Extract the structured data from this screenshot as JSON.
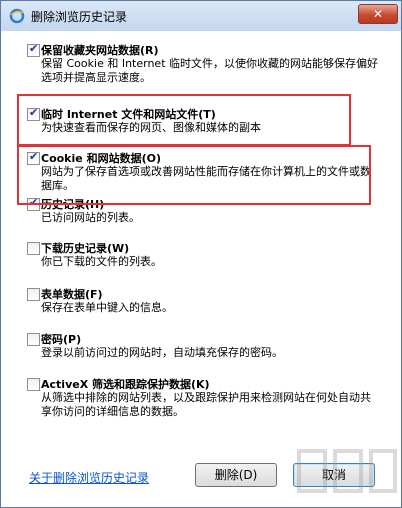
{
  "window": {
    "title": "删除浏览历史记录",
    "close_glyph": "✕"
  },
  "options": [
    {
      "title": "保留收藏夹网站数据(R)",
      "desc": "保留 Cookie 和 Internet 临时文件，以使你收藏的网站能够保存偏好选项并提高显示速度。",
      "checked": true
    },
    {
      "title": "临时 Internet 文件和网站文件(T)",
      "desc": "为快速查看而保存的网页、图像和媒体的副本",
      "checked": true
    },
    {
      "title": "Cookie 和网站数据(O)",
      "desc": "网站为了保存首选项或改善网站性能而存储在你计算机上的文件或数据库。",
      "checked": true
    },
    {
      "title": "历史记录(H)",
      "desc": "已访问网站的列表。",
      "checked": true
    },
    {
      "title": "下载历史记录(W)",
      "desc": "你已下载的文件的列表。",
      "checked": false
    },
    {
      "title": "表单数据(F)",
      "desc": "保存在表单中键入的信息。",
      "checked": false
    },
    {
      "title": "密码(P)",
      "desc": "登录以前访问过的网站时，自动填充保存的密码。",
      "checked": false
    },
    {
      "title": "ActiveX 筛选和跟踪保护数据(K)",
      "desc": "从筛选中排除的网站列表，以及跟踪保护用来检测网站在何处自动共享你访问的详细信息的数据。",
      "checked": false
    }
  ],
  "footer": {
    "link": "关于删除浏览历史记录",
    "delete_button": "删除(D)",
    "cancel_button": "取消"
  }
}
